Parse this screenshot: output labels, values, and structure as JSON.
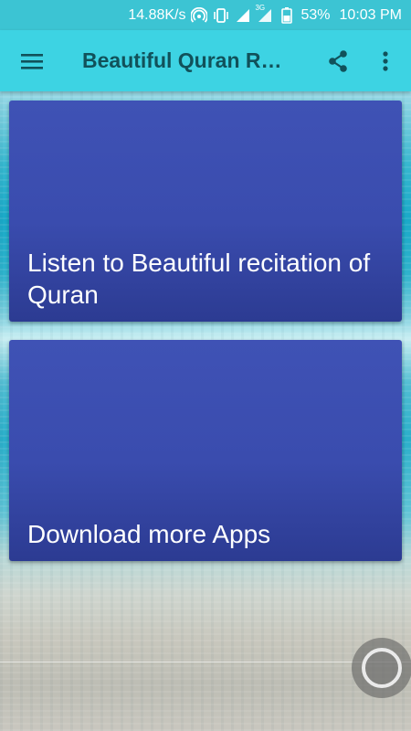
{
  "status_bar": {
    "net_speed": "14.88K/s",
    "network_type": "3G",
    "battery": "53%",
    "time": "10:03 PM",
    "icons": [
      "hotspot-icon",
      "vibrate-icon",
      "signal-icon",
      "signal-3g-icon",
      "battery-icon"
    ]
  },
  "app_bar": {
    "title": "Beautiful Quran Rec...",
    "menu_icon": "hamburger-menu-icon",
    "share_icon": "share-icon",
    "more_icon": "more-vertical-icon"
  },
  "cards": [
    {
      "label": "Listen to Beautiful recitation of Quran"
    },
    {
      "label": "Download more Apps"
    }
  ],
  "colors": {
    "status_bar": "#3cc4d3",
    "app_bar": "#3dd3e3",
    "title_text": "#11515a",
    "card": "#3f52b5"
  }
}
